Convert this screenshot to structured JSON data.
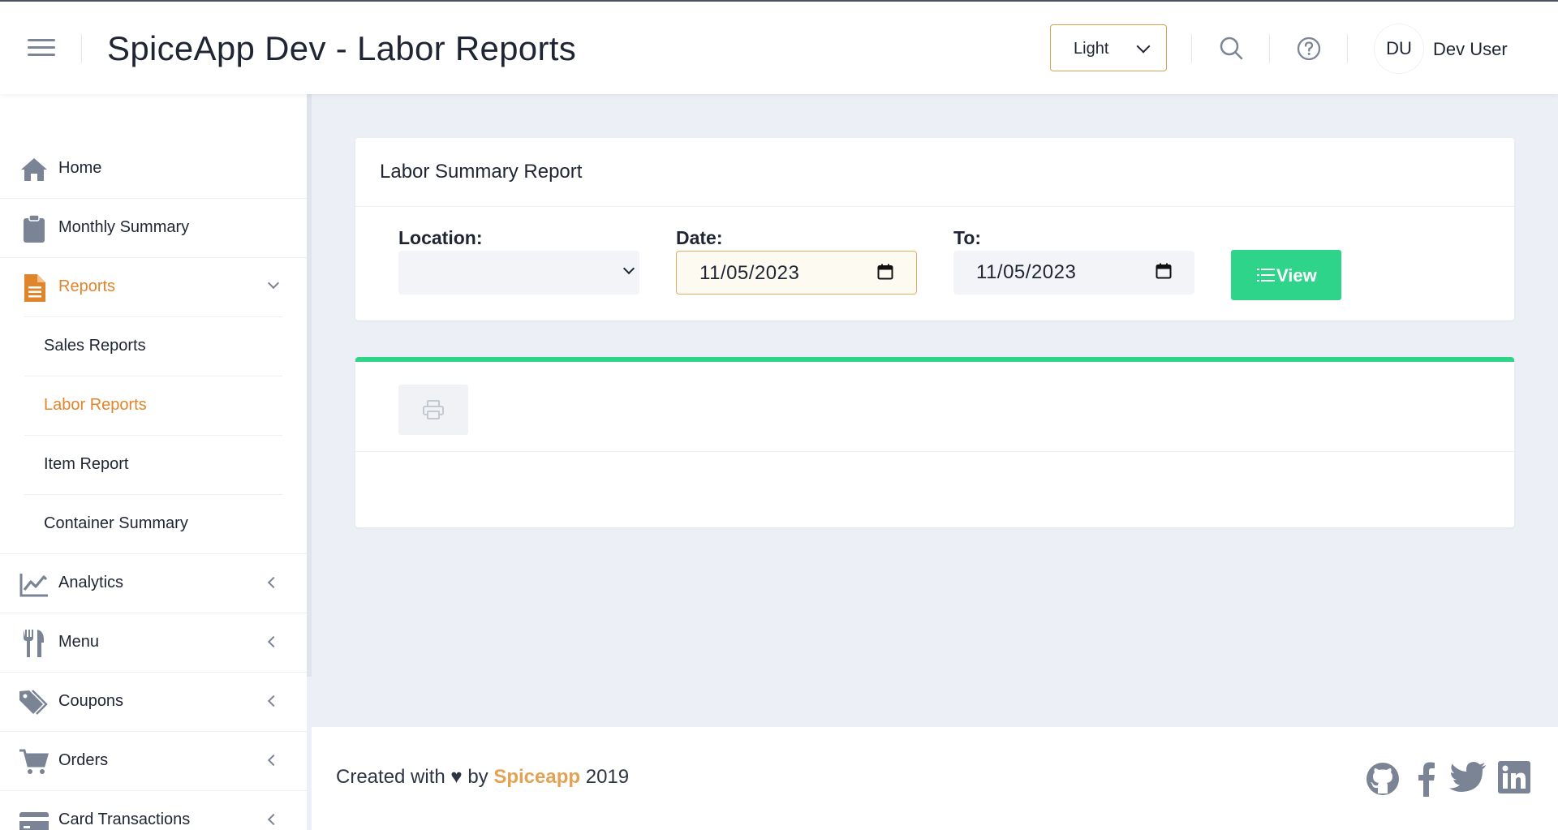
{
  "header": {
    "title": "SpiceApp Dev - Labor Reports",
    "theme_select": "Light",
    "avatar_initials": "DU",
    "username": "Dev User"
  },
  "sidebar": {
    "items": [
      {
        "label": "Home",
        "icon": "home-icon"
      },
      {
        "label": "Monthly Summary",
        "icon": "clipboard-icon"
      },
      {
        "label": "Reports",
        "icon": "document-icon",
        "active": true,
        "expanded": true
      },
      {
        "label": "Analytics",
        "icon": "chart-line-icon"
      },
      {
        "label": "Menu",
        "icon": "utensils-icon"
      },
      {
        "label": "Coupons",
        "icon": "tags-icon"
      },
      {
        "label": "Orders",
        "icon": "cart-icon"
      },
      {
        "label": "Card Transactions",
        "icon": "credit-card-icon"
      }
    ],
    "reports_sub": [
      {
        "label": "Sales Reports"
      },
      {
        "label": "Labor Reports",
        "active": true
      },
      {
        "label": "Item Report"
      },
      {
        "label": "Container Summary"
      }
    ]
  },
  "report": {
    "title": "Labor Summary Report",
    "location_label": "Location:",
    "location_value": "",
    "date_label": "Date:",
    "date_value": "11/05/2023",
    "to_label": "To:",
    "to_value": "11/05/2023",
    "view_label": "View"
  },
  "footer": {
    "prefix": "Created with ♥ by",
    "brand": "Spiceapp",
    "year": "2019"
  },
  "colors": {
    "accent": "#e0852c",
    "success": "#2ed48a",
    "brand_footer": "#e3a253"
  }
}
